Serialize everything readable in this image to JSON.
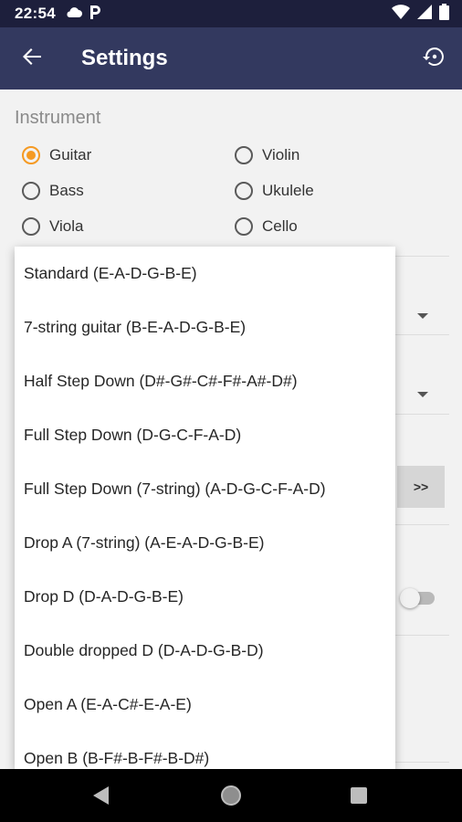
{
  "status_bar": {
    "time": "22:54",
    "left_icons": [
      "cloud-icon",
      "parking-p-icon"
    ],
    "right_icons": [
      "wifi-icon",
      "signal-icon",
      "battery-icon"
    ]
  },
  "app_bar": {
    "title": "Settings",
    "back_icon": "arrow-left-icon",
    "reset_icon": "restore-icon"
  },
  "instrument": {
    "section_title": "Instrument",
    "options": [
      {
        "label": "Guitar",
        "selected": true
      },
      {
        "label": "Violin",
        "selected": false
      },
      {
        "label": "Bass",
        "selected": false
      },
      {
        "label": "Ukulele",
        "selected": false
      },
      {
        "label": "Viola",
        "selected": false
      },
      {
        "label": "Cello",
        "selected": false
      }
    ]
  },
  "more_button": {
    "label": ">>"
  },
  "tuning_menu": {
    "items": [
      "Standard (E-A-D-G-B-E)",
      "7-string guitar (B-E-A-D-G-B-E)",
      "Half Step Down (D#-G#-C#-F#-A#-D#)",
      "Full Step Down (D-G-C-F-A-D)",
      "Full Step Down (7-string) (A-D-G-C-F-A-D)",
      "Drop A (7-string) (A-E-A-D-G-B-E)",
      "Drop D (D-A-D-G-B-E)",
      "Double dropped D (D-A-D-G-B-D)",
      "Open A (E-A-C#-E-A-E)",
      "Open B (B-F#-B-F#-B-D#)"
    ]
  },
  "colors": {
    "app_bar": "#33395f",
    "status_bar": "#1d1f3c",
    "accent": "#f59a23"
  },
  "nav_bar": {
    "icons": [
      "back-triangle-icon",
      "home-circle-icon",
      "recents-square-icon"
    ]
  }
}
